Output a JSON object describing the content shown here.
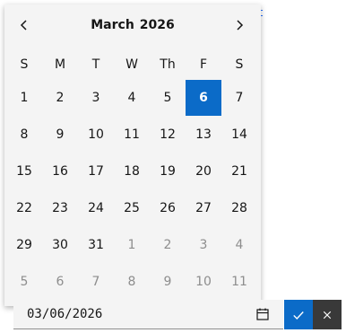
{
  "background_link": "t",
  "calendar": {
    "month": "March",
    "year": "2026",
    "prev_icon": "chevron-left-icon",
    "next_icon": "chevron-right-icon",
    "weekdays": [
      "S",
      "M",
      "T",
      "W",
      "Th",
      "F",
      "S"
    ],
    "weeks": [
      [
        {
          "d": "1",
          "o": false
        },
        {
          "d": "2",
          "o": false
        },
        {
          "d": "3",
          "o": false
        },
        {
          "d": "4",
          "o": false
        },
        {
          "d": "5",
          "o": false
        },
        {
          "d": "6",
          "o": false,
          "selected": true
        },
        {
          "d": "7",
          "o": false
        }
      ],
      [
        {
          "d": "8",
          "o": false
        },
        {
          "d": "9",
          "o": false
        },
        {
          "d": "10",
          "o": false
        },
        {
          "d": "11",
          "o": false
        },
        {
          "d": "12",
          "o": false
        },
        {
          "d": "13",
          "o": false
        },
        {
          "d": "14",
          "o": false
        }
      ],
      [
        {
          "d": "15",
          "o": false
        },
        {
          "d": "16",
          "o": false
        },
        {
          "d": "17",
          "o": false
        },
        {
          "d": "18",
          "o": false
        },
        {
          "d": "19",
          "o": false
        },
        {
          "d": "20",
          "o": false
        },
        {
          "d": "21",
          "o": false
        }
      ],
      [
        {
          "d": "22",
          "o": false
        },
        {
          "d": "23",
          "o": false
        },
        {
          "d": "24",
          "o": false
        },
        {
          "d": "25",
          "o": false
        },
        {
          "d": "26",
          "o": false
        },
        {
          "d": "27",
          "o": false
        },
        {
          "d": "28",
          "o": false
        }
      ],
      [
        {
          "d": "29",
          "o": false
        },
        {
          "d": "30",
          "o": false
        },
        {
          "d": "31",
          "o": false
        },
        {
          "d": "1",
          "o": true
        },
        {
          "d": "2",
          "o": true
        },
        {
          "d": "3",
          "o": true
        },
        {
          "d": "4",
          "o": true
        }
      ],
      [
        {
          "d": "5",
          "o": true
        },
        {
          "d": "6",
          "o": true
        },
        {
          "d": "7",
          "o": true
        },
        {
          "d": "8",
          "o": true
        },
        {
          "d": "9",
          "o": true
        },
        {
          "d": "10",
          "o": true
        },
        {
          "d": "11",
          "o": true
        }
      ]
    ]
  },
  "date_input": {
    "value": "03/06/2026",
    "icon": "calendar-icon"
  },
  "confirm_icon": "checkmark-icon",
  "cancel_icon": "close-icon",
  "colors": {
    "accent": "#0b6bc8",
    "surface": "#f4f4f4",
    "dark_button": "#393939",
    "text": "#161616",
    "muted_text": "#8d8d8d"
  }
}
